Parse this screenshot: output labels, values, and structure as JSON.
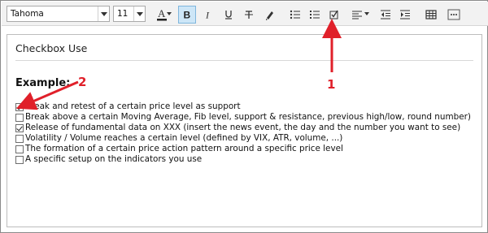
{
  "toolbar": {
    "font_name": "Tahoma",
    "font_size": "11",
    "buttons": [
      {
        "name": "text-color-icon",
        "glyph": "A"
      },
      {
        "name": "bold-icon",
        "glyph": "B"
      },
      {
        "name": "italic-icon",
        "glyph": "I"
      },
      {
        "name": "underline-icon",
        "glyph": "U"
      },
      {
        "name": "strikethrough-icon",
        "glyph": "T"
      },
      {
        "name": "highlight-icon"
      },
      {
        "name": "bulleted-list-icon"
      },
      {
        "name": "numbered-list-icon"
      },
      {
        "name": "checkbox-list-icon"
      },
      {
        "name": "align-icon"
      },
      {
        "name": "decrease-indent-icon"
      },
      {
        "name": "increase-indent-icon"
      },
      {
        "name": "table-icon"
      },
      {
        "name": "more-icon"
      }
    ],
    "active_color": "#cde6f7"
  },
  "panel": {
    "title": "Checkbox Use",
    "heading": "Example:",
    "items": [
      {
        "checked": true,
        "text": "Break and retest of a certain price level as support"
      },
      {
        "checked": false,
        "text": "Break above a certain Moving Average, Fib level, support & resistance, previous high/low, round number)"
      },
      {
        "checked": true,
        "text": "Release of fundamental data on XXX (insert the news event, the day and the number you want to see)"
      },
      {
        "checked": false,
        "text": "Volatility / Volume reaches a certain level (defined by VIX, ATR, volume, ...)"
      },
      {
        "checked": false,
        "text": "The formation of a certain price action pattern around a specific price level"
      },
      {
        "checked": false,
        "text": "A specific setup on the indicators you use"
      }
    ]
  },
  "annotations": {
    "label_1": "1",
    "label_2": "2",
    "color": "#e0202a"
  }
}
